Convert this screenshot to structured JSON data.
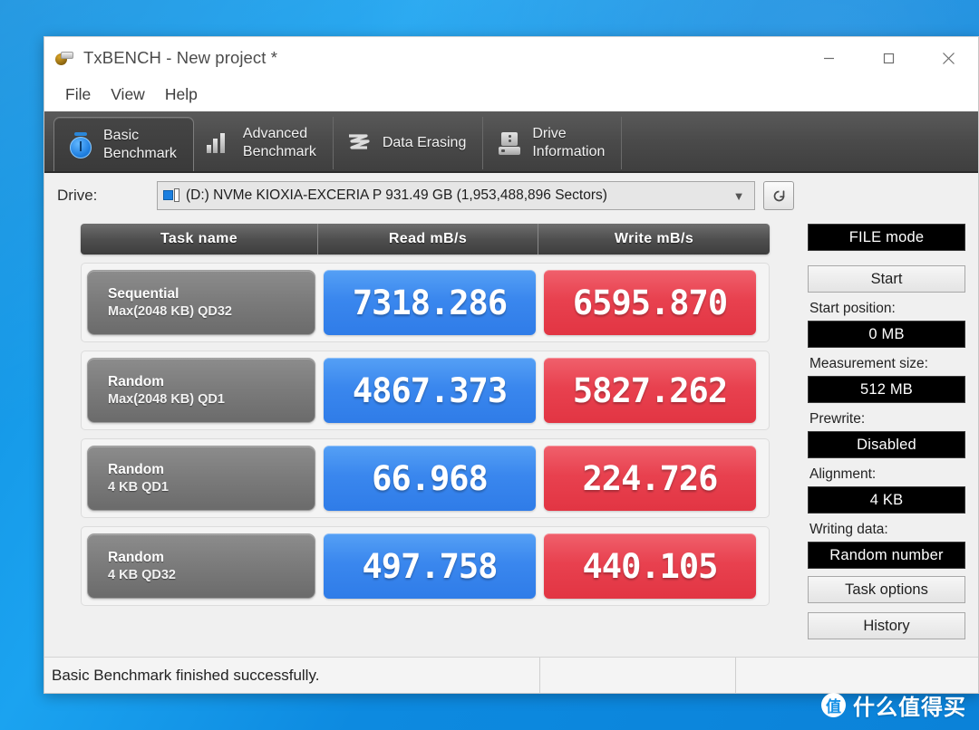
{
  "window": {
    "title": "TxBENCH - New project *",
    "icon": "app-disc-icon",
    "controls": {
      "minimize": "minimize-icon",
      "maximize": "maximize-icon",
      "close": "close-icon"
    }
  },
  "menu": {
    "items": [
      {
        "label": "File"
      },
      {
        "label": "View"
      },
      {
        "label": "Help"
      }
    ]
  },
  "tabs": [
    {
      "label": "Basic\nBenchmark",
      "icon": "stopwatch-icon",
      "active": true
    },
    {
      "label": "Advanced\nBenchmark",
      "icon": "bar-chart-icon",
      "active": false
    },
    {
      "label": "Data Erasing",
      "icon": "eraser-icon",
      "active": false
    },
    {
      "label": "Drive\nInformation",
      "icon": "hard-drive-icon",
      "active": false
    }
  ],
  "drive": {
    "label": "Drive:",
    "selected": "(D:) NVMe KIOXIA-EXCERIA P  931.49 GB (1,953,488,896 Sectors)",
    "dropdown_icon": "chevron-down-icon",
    "refresh_icon": "refresh-icon"
  },
  "table": {
    "headers": [
      "Task name",
      "Read mB/s",
      "Write mB/s"
    ],
    "rows": [
      {
        "task_line1": "Sequential",
        "task_line2": "Max(2048 KB) QD32",
        "read": "7318.286",
        "write": "6595.870"
      },
      {
        "task_line1": "Random",
        "task_line2": "Max(2048 KB) QD1",
        "read": "4867.373",
        "write": "5827.262"
      },
      {
        "task_line1": "Random",
        "task_line2": "4 KB QD1",
        "read": "66.968",
        "write": "224.726"
      },
      {
        "task_line1": "Random",
        "task_line2": "4 KB QD32",
        "read": "497.758",
        "write": "440.105"
      }
    ]
  },
  "sidebar": {
    "mode": "FILE mode",
    "start_button": "Start",
    "start_position_label": "Start position:",
    "start_position_value": "0 MB",
    "measurement_size_label": "Measurement size:",
    "measurement_size_value": "512 MB",
    "prewrite_label": "Prewrite:",
    "prewrite_value": "Disabled",
    "alignment_label": "Alignment:",
    "alignment_value": "4 KB",
    "writing_data_label": "Writing data:",
    "writing_data_value": "Random number",
    "task_options_button": "Task options",
    "history_button": "History"
  },
  "statusbar": {
    "message": "Basic Benchmark finished successfully.",
    "segment2": "",
    "segment3": ""
  },
  "watermark": {
    "badge": "值",
    "text": "什么值得买"
  },
  "colors": {
    "read_blue": "#3a87ee",
    "write_red": "#e8414f",
    "desktop_blue": "#139ceb",
    "tab_dark": "#4a4a4a",
    "lcd_black": "#000000"
  }
}
